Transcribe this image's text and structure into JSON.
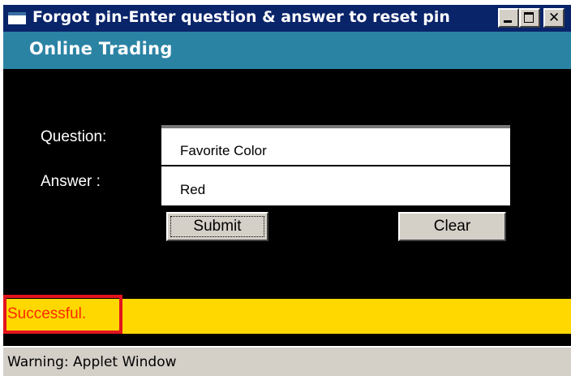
{
  "window": {
    "title": "Forgot pin-Enter question & answer to reset pin"
  },
  "app": {
    "name": "Online Trading"
  },
  "form": {
    "question_label": "Question:",
    "question_value": "Favorite Color",
    "answer_label": "Answer :",
    "answer_value": "Red",
    "submit_label": "Submit",
    "clear_label": "Clear"
  },
  "status": {
    "message": "Successful.",
    "bar_color": "#ffd800",
    "text_color": "#ff2a00"
  },
  "warning": {
    "text": "Warning: Applet Window"
  }
}
